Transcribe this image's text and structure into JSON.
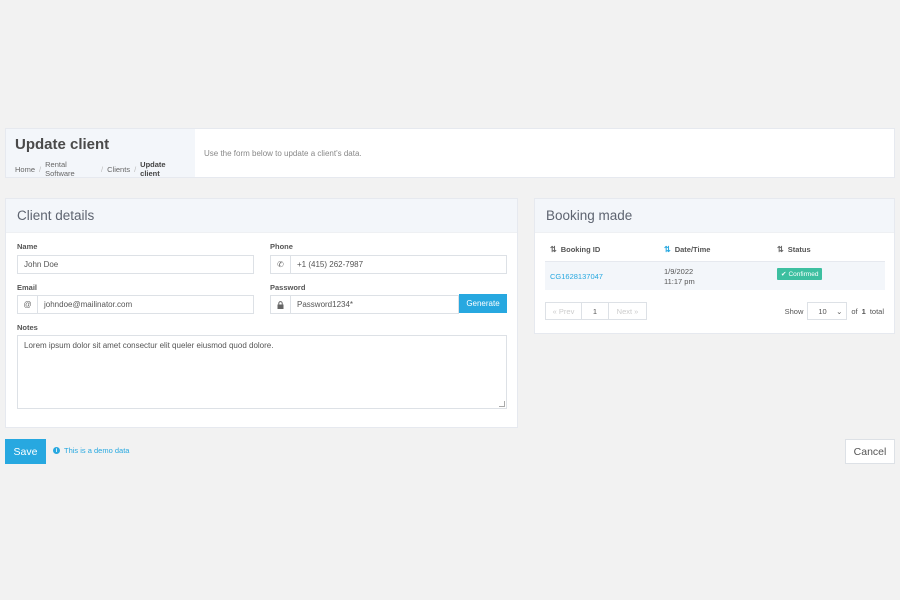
{
  "header": {
    "title": "Update client",
    "breadcrumb": [
      "Home",
      "Rental Software",
      "Clients",
      "Update client"
    ],
    "description": "Use the form below to update a client's data."
  },
  "client_details": {
    "heading": "Client details",
    "name": {
      "label": "Name",
      "value": "John Doe"
    },
    "phone": {
      "label": "Phone",
      "value": "+1 (415) 262-7987",
      "icon": "phone-icon"
    },
    "email": {
      "label": "Email",
      "value": "johndoe@mailinator.com",
      "icon": "at-icon"
    },
    "password": {
      "label": "Password",
      "value": "Password1234*",
      "icon": "lock-icon",
      "generate_label": "Generate"
    },
    "notes": {
      "label": "Notes",
      "value": "Lorem ipsum dolor sit amet consectur elit queler eiusmod quod dolore."
    }
  },
  "booking": {
    "heading": "Booking made",
    "columns": [
      "Booking ID",
      "Date/Time",
      "Status"
    ],
    "rows": [
      {
        "id": "CG1628137047",
        "date": "1/9/2022",
        "time": "11:17 pm",
        "status": "Confirmed"
      }
    ],
    "pager": {
      "prev": "« Prev",
      "page": "1",
      "next": "Next »"
    },
    "show_label": "Show",
    "page_size": "10",
    "of_label": "of",
    "total_pages": "1",
    "total_label": "total"
  },
  "footer": {
    "save_label": "Save",
    "demo_note": "This is a demo data",
    "cancel_label": "Cancel"
  },
  "colors": {
    "accent": "#27a8e0",
    "success": "#3dbfa0"
  }
}
